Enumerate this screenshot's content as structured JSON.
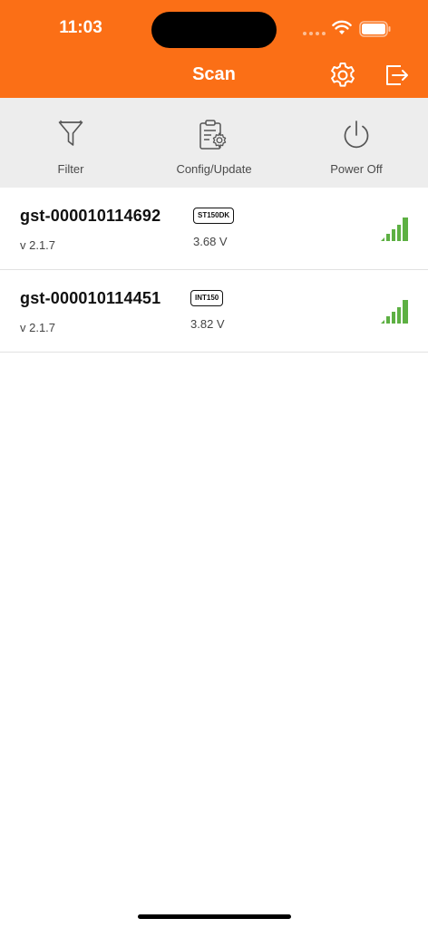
{
  "status_bar": {
    "time": "11:03"
  },
  "header": {
    "title": "Scan",
    "settings_icon": "gear-icon",
    "logout_icon": "logout-icon",
    "background": "#FB6F16"
  },
  "toolbar": {
    "filter_label": "Filter",
    "config_label": "Config/Update",
    "power_label": "Power Off"
  },
  "devices": [
    {
      "name": "gst-000010114692",
      "model": "ST150DK",
      "version": "v 2.1.7",
      "voltage": "3.68 V",
      "signal_bars": 5
    },
    {
      "name": "gst-000010114451",
      "model": "INT150",
      "version": "v 2.1.7",
      "voltage": "3.82 V",
      "signal_bars": 5
    }
  ],
  "colors": {
    "accent": "#FB6F16",
    "signal": "#5DB043"
  }
}
